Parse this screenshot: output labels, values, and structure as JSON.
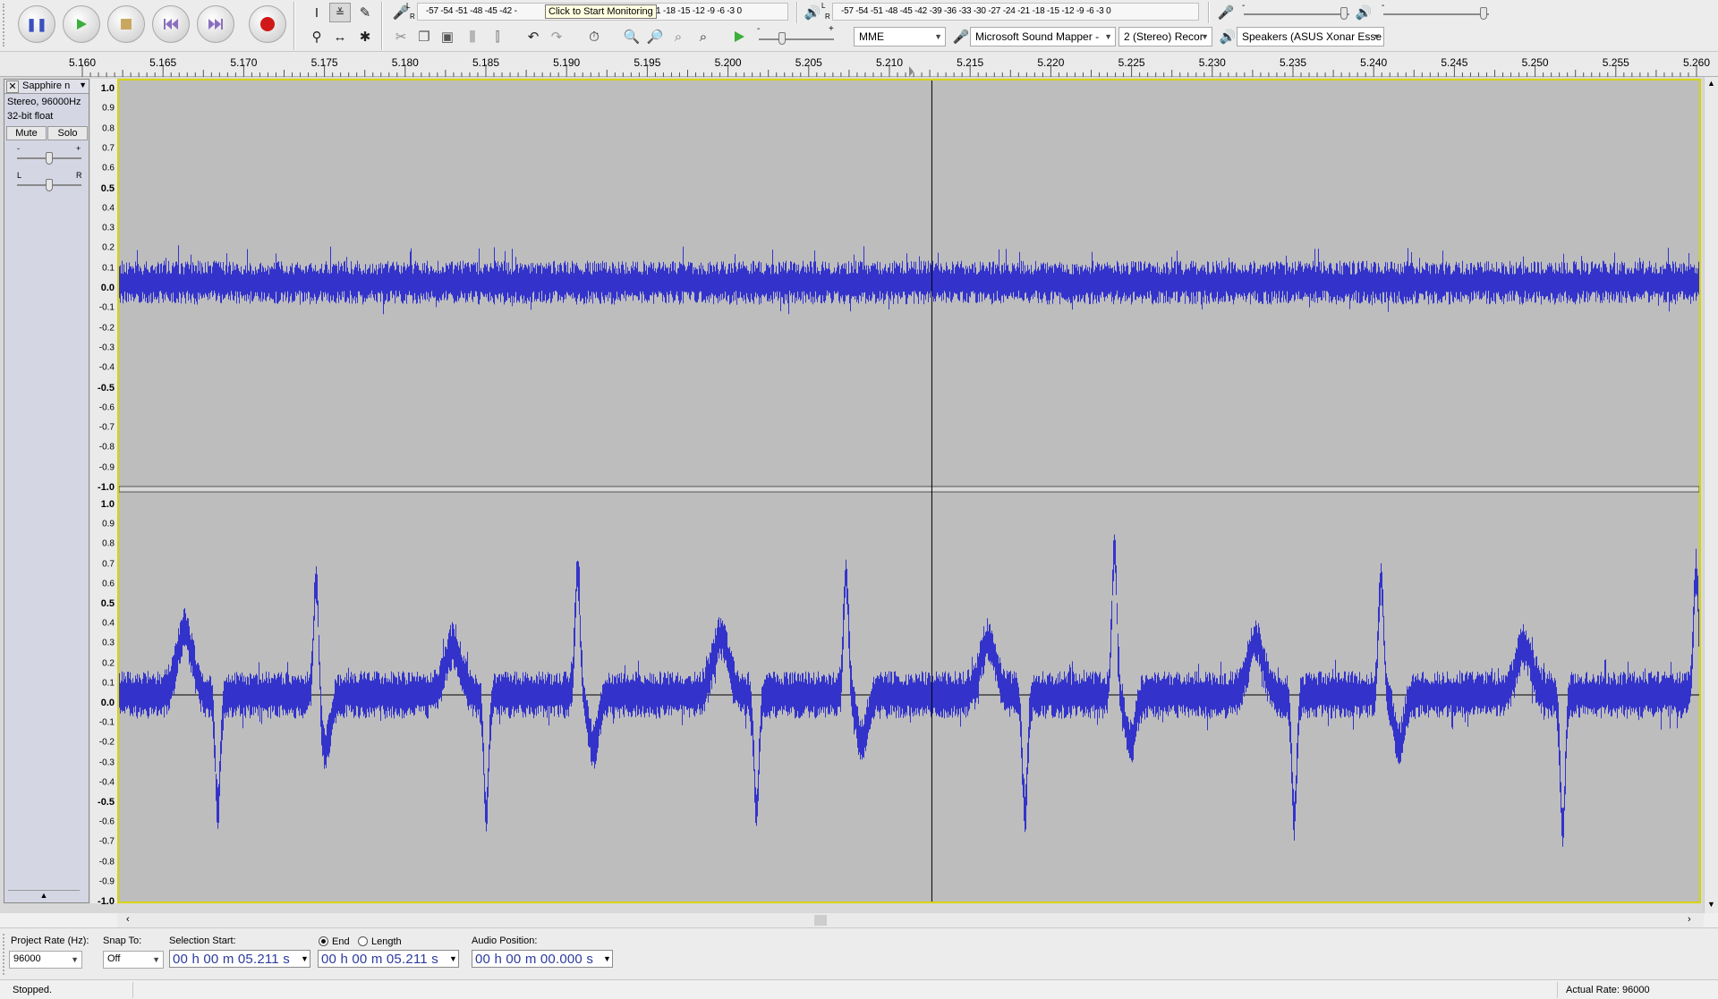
{
  "toolbar": {
    "pause": "pause",
    "play": "play",
    "stop": "stop",
    "skip_start": "skip-to-start",
    "skip_end": "skip-to-end",
    "record": "record",
    "rec_meter_scale": "-57 -54 -51 -48 -45 -42 -",
    "rec_meter_scale_right": "1 -18 -15 -12 -9 -6 -3 0",
    "tooltip": "Click to Start Monitoring",
    "play_meter_scale": "-57 -54 -51 -48 -45 -42 -39 -36 -33 -30 -27 -24 -21 -18 -15 -12 -9 -6 -3 0",
    "lr_left": "L",
    "lr_right": "R",
    "host": "MME",
    "recording_device": "Microsoft Sound Mapper -",
    "channels": "2 (Stereo) Recor",
    "playback_device": "Speakers (ASUS Xonar Esse",
    "play_speed_minus": "-",
    "play_speed_plus": "+",
    "rec_vol_minus": "-",
    "play_vol_minus": "-"
  },
  "ruler": {
    "labels": [
      "5.160",
      "5.165",
      "5.170",
      "5.175",
      "5.180",
      "5.185",
      "5.190",
      "5.195",
      "5.200",
      "5.205",
      "5.210",
      "5.215",
      "5.220",
      "5.225",
      "5.230",
      "5.235",
      "5.240",
      "5.245",
      "5.250",
      "5.255",
      "5.260"
    ]
  },
  "track": {
    "name": "Sapphire n",
    "format": "Stereo, 96000Hz",
    "bitdepth": "32-bit float",
    "mute": "Mute",
    "solo": "Solo",
    "gain_minus": "-",
    "gain_plus": "+",
    "pan_left": "L",
    "pan_right": "R",
    "collapse": "▲"
  },
  "vruler": {
    "labels": [
      "1.0",
      "0.9",
      "0.8",
      "0.7",
      "0.6",
      "0.5",
      "0.4",
      "0.3",
      "0.2",
      "0.1",
      "0.0",
      "-0.1",
      "-0.2",
      "-0.3",
      "-0.4",
      "-0.5",
      "-0.6",
      "-0.7",
      "-0.8",
      "-0.9",
      "-1.0"
    ]
  },
  "waveform": {
    "color": "#3333cc",
    "cursor_time_s": 5.211,
    "view_start_s": 5.1574,
    "view_end_s": 5.2616
  },
  "selection": {
    "project_rate_label": "Project Rate (Hz):",
    "project_rate": "96000",
    "snap_label": "Snap To:",
    "snap": "Off",
    "sel_start_label": "Selection Start:",
    "end_label": "End",
    "length_label": "Length",
    "audio_pos_label": "Audio Position:",
    "sel_start": "00 h 00 m 05.211 s",
    "sel_end": "00 h 00 m 05.211 s",
    "audio_pos": "00 h 00 m 00.000 s"
  },
  "status": {
    "text": "Stopped.",
    "rate": "Actual Rate: 96000"
  }
}
